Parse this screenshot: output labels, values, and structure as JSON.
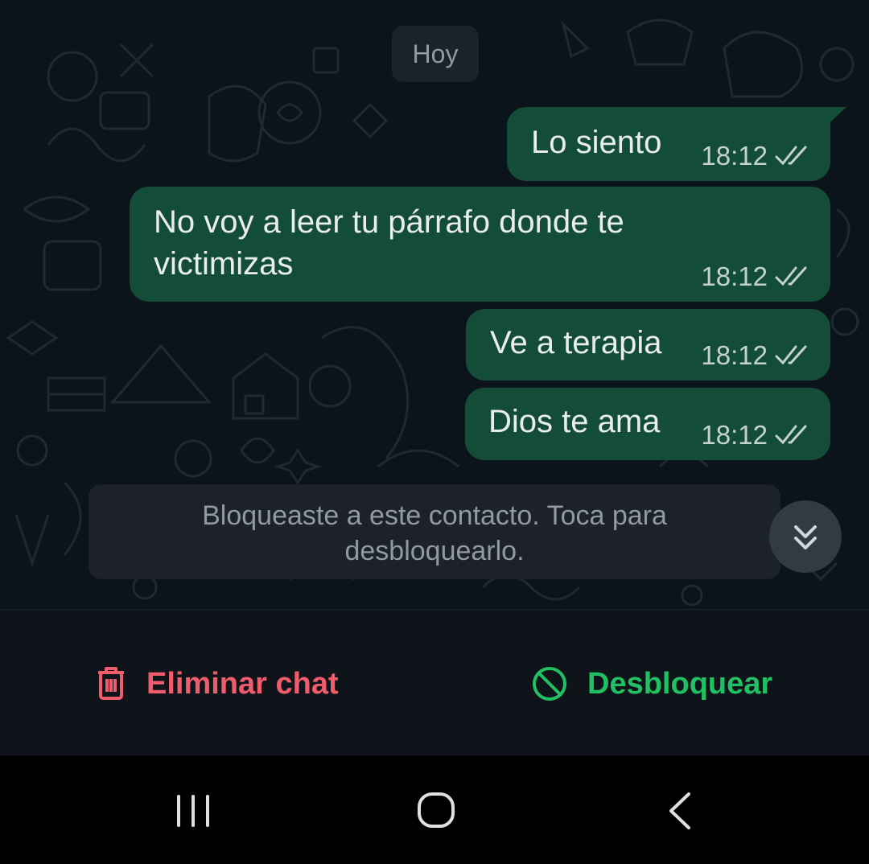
{
  "chat": {
    "date_chip": "Hoy",
    "messages": [
      {
        "text": "Lo siento",
        "time": "18:12",
        "status": "read"
      },
      {
        "text": "No voy a leer tu párrafo donde te victimizas",
        "time": "18:12",
        "status": "read"
      },
      {
        "text": "Ve a terapia",
        "time": "18:12",
        "status": "read"
      },
      {
        "text": "Dios te ama",
        "time": "18:12",
        "status": "read"
      }
    ],
    "blocked_notice": "Bloqueaste a este contacto. Toca para desbloquearlo."
  },
  "actions": {
    "delete_label": "Eliminar chat",
    "unblock_label": "Desbloquear"
  },
  "icons": {
    "delete": "trash-icon",
    "unblock": "block-icon",
    "scroll_down": "double-chevron-down-icon",
    "read_status": "double-check-icon",
    "nav_recent": "recent-apps-icon",
    "nav_home": "home-icon",
    "nav_back": "back-icon"
  },
  "colors": {
    "background": "#0b141a",
    "bubble_out": "#144d37",
    "delete": "#f15c6d",
    "unblock": "#21c063",
    "notice_text": "#8f9aa1"
  }
}
